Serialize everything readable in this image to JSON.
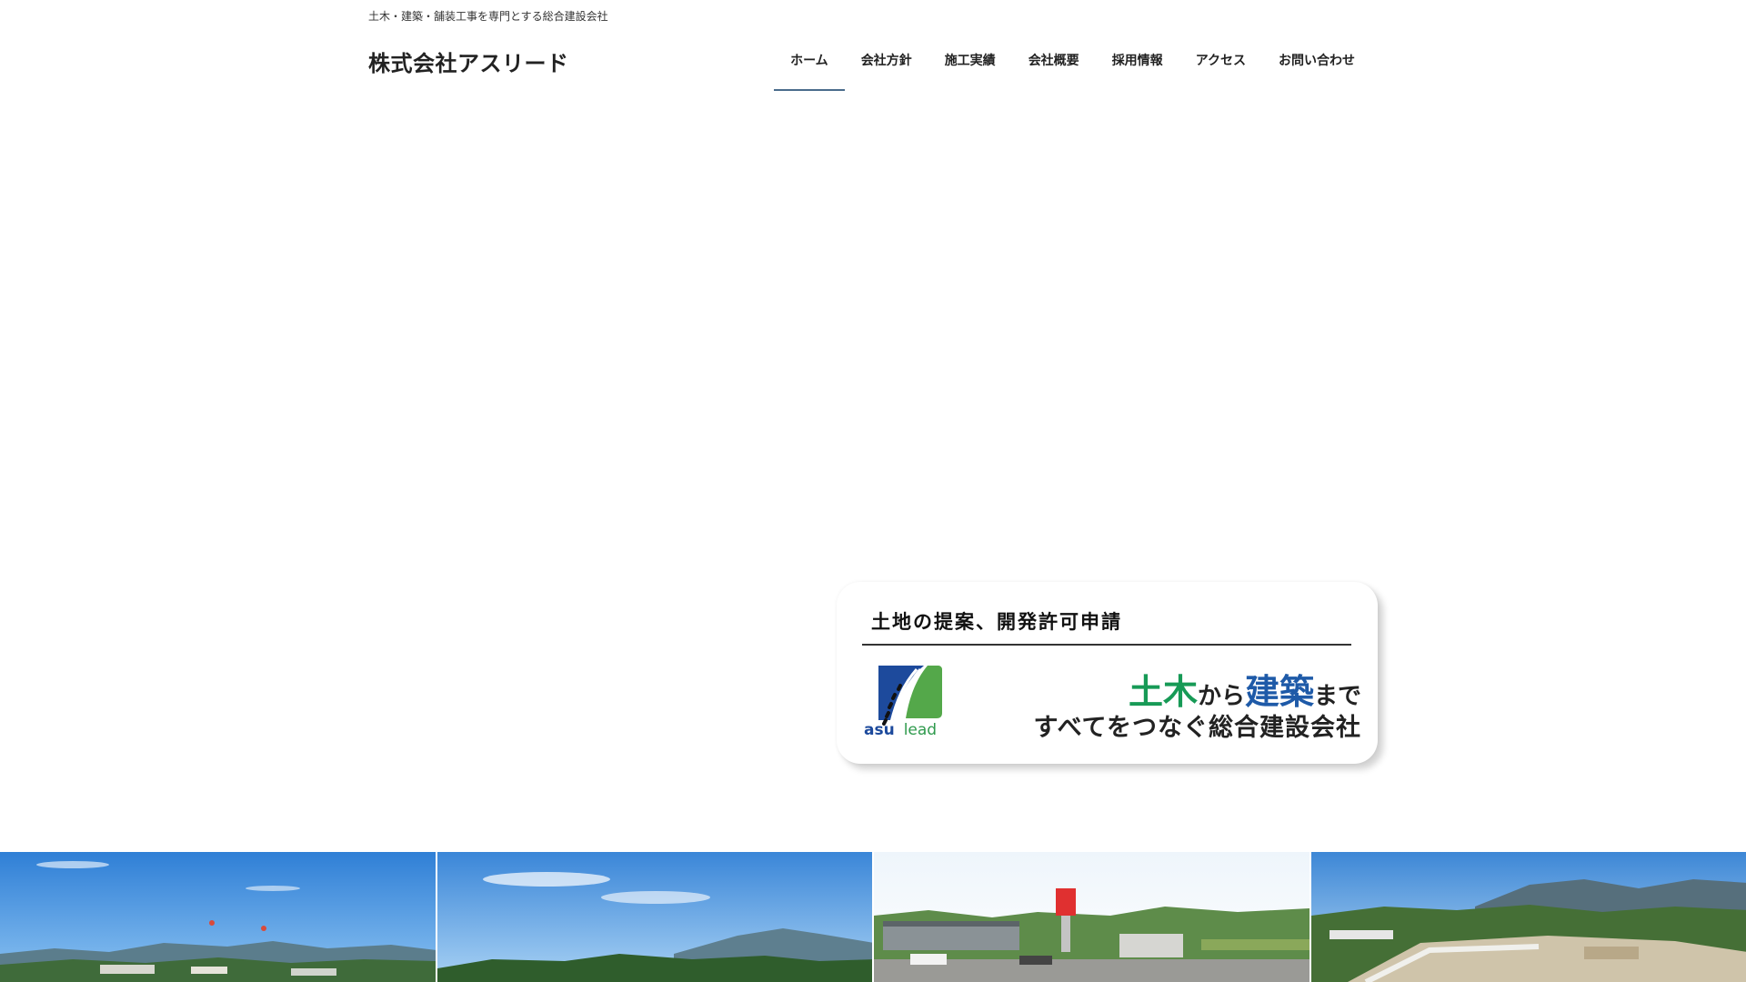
{
  "header": {
    "tagline": "土木・建築・舗装工事を専門とする総合建設会社",
    "site_title": "株式会社アスリード"
  },
  "nav": {
    "items": [
      {
        "label": "ホーム",
        "active": true
      },
      {
        "label": "会社方針"
      },
      {
        "label": "施工実績"
      },
      {
        "label": "会社概要"
      },
      {
        "label": "採用情報"
      },
      {
        "label": "アクセス"
      },
      {
        "label": "お問い合わせ"
      }
    ]
  },
  "banner": {
    "heading": "土地の提案、開発許可申請",
    "logo": {
      "part1": "asu",
      "part2": "lead",
      "icon": "road-logo-icon"
    },
    "slogan_line1": {
      "w1": "土木",
      "w2": "から",
      "w3": "建築",
      "w4": "まで"
    },
    "slogan_line2": "すべてをつなぐ総合建設会社"
  },
  "colors": {
    "nav_active_underline": "#4a6c8c",
    "slogan_green": "#179a56",
    "slogan_blue": "#1e5aa8",
    "logo_blue": "#1d4a9c",
    "logo_green": "#2f9a4d"
  }
}
